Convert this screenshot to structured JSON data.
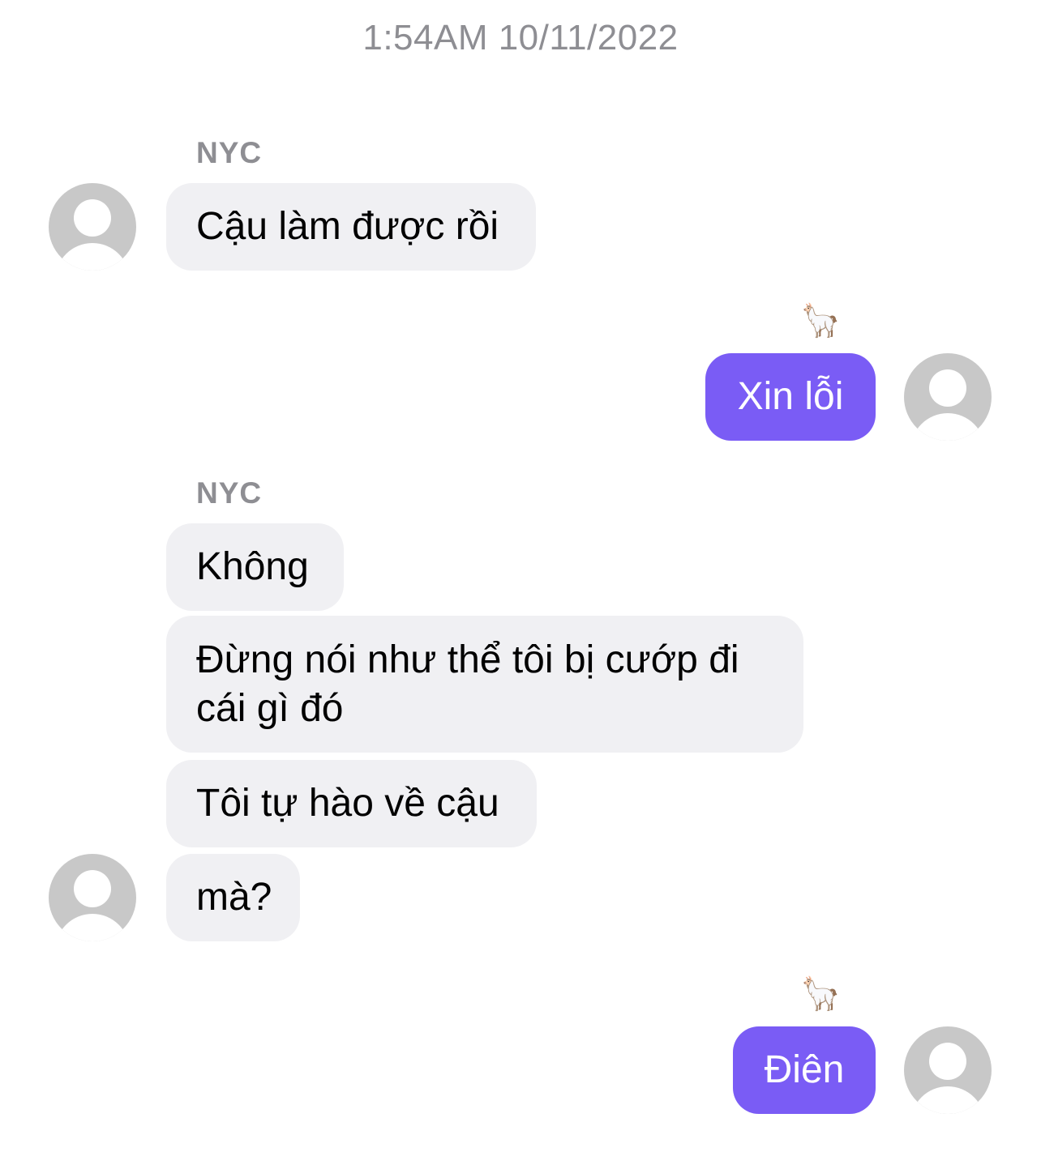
{
  "timestamp": "1:54AM 10/11/2022",
  "contact_name": "NYC",
  "messages": [
    {
      "sender": "NYC",
      "text": "Cậu làm được rồi"
    },
    {
      "sender": "me",
      "text": "Xin lỗi",
      "reaction": "🦙"
    },
    {
      "sender": "NYC",
      "text": "Không"
    },
    {
      "sender": "NYC",
      "text": "Đừng nói như thể tôi bị cướp đi\ncái gì đó"
    },
    {
      "sender": "NYC",
      "text": "Tôi tự hào về cậu"
    },
    {
      "sender": "NYC",
      "text": "mà?"
    },
    {
      "sender": "me",
      "text": "Điên",
      "reaction": "🦙"
    }
  ],
  "colors": {
    "outgoing_bubble": "#7a5cf5",
    "incoming_bubble": "#f0f0f3",
    "meta_text": "#8e8e93",
    "avatar": "#c8c8c8"
  },
  "icons": {
    "avatar": "person-placeholder-icon",
    "reaction": "llama-emoji"
  }
}
